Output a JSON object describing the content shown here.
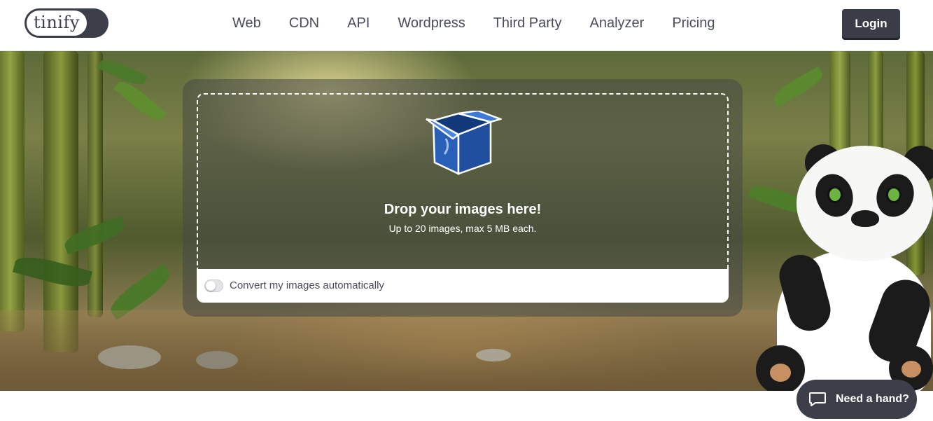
{
  "header": {
    "logo_text": "tinify",
    "nav_items": [
      "Web",
      "CDN",
      "API",
      "Wordpress",
      "Third Party",
      "Analyzer",
      "Pricing"
    ],
    "login_label": "Login"
  },
  "upload": {
    "title": "Drop your images here!",
    "subtitle": "Up to 20 images, max 5 MB each.",
    "convert_label": "Convert my images automatically",
    "convert_enabled": false
  },
  "help": {
    "label": "Need a hand?"
  },
  "colors": {
    "header_bg": "#ffffff",
    "dark": "#3c3f4a",
    "box_blue": "#2f6fd0"
  },
  "icons": [
    "box-icon",
    "chat-bubble-icon",
    "toggle-switch"
  ]
}
